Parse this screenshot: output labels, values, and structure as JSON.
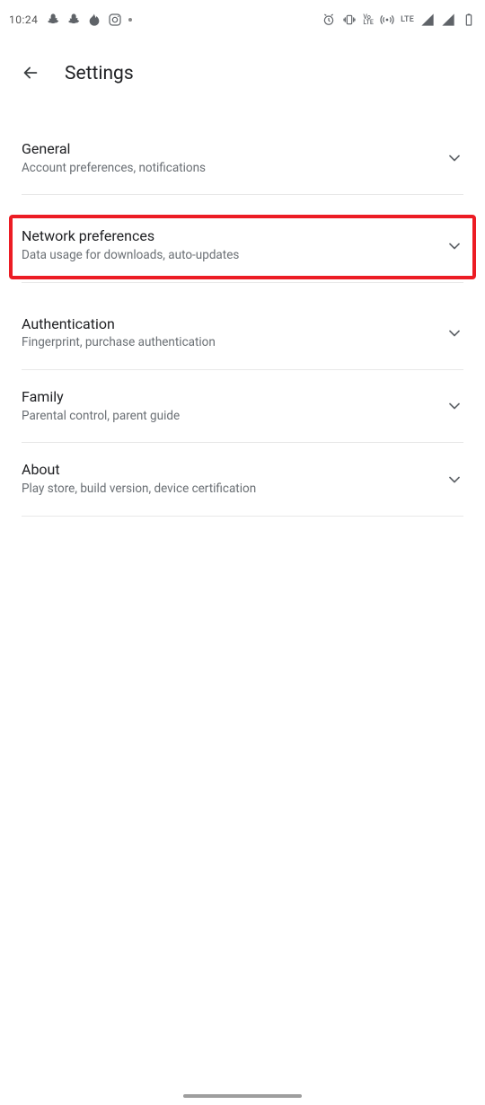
{
  "status": {
    "clock": "10:24",
    "lte_label": "LTE",
    "volte_label": "Vo\nLTE"
  },
  "header": {
    "title": "Settings"
  },
  "rows": {
    "general": {
      "title": "General",
      "sub": "Account preferences, notifications"
    },
    "network": {
      "title": "Network preferences",
      "sub": "Data usage for downloads, auto-updates"
    },
    "auth": {
      "title": "Authentication",
      "sub": "Fingerprint, purchase authentication"
    },
    "family": {
      "title": "Family",
      "sub": "Parental control, parent guide"
    },
    "about": {
      "title": "About",
      "sub": "Play store, build version, device certification"
    }
  },
  "highlight_color": "#ec1c24"
}
